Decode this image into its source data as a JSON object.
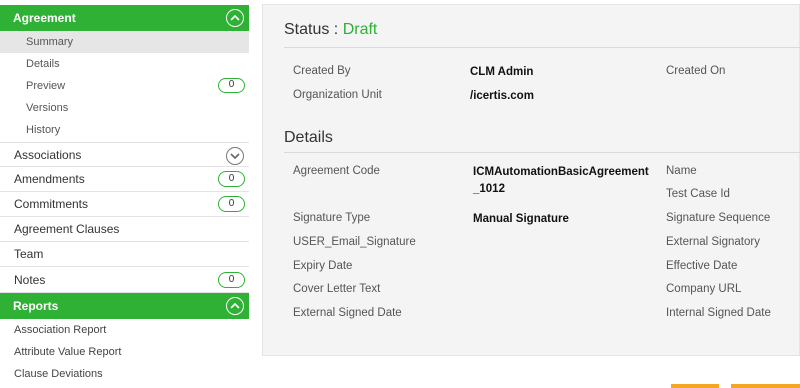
{
  "sidebar": {
    "agreement_header": "Agreement",
    "agreement_items": [
      {
        "label": "Summary"
      },
      {
        "label": "Details"
      },
      {
        "label": "Preview",
        "count": "0"
      },
      {
        "label": "Versions"
      },
      {
        "label": "History"
      }
    ],
    "categories": [
      {
        "label": "Associations"
      },
      {
        "label": "Amendments",
        "count": "0"
      },
      {
        "label": "Commitments",
        "count": "0"
      },
      {
        "label": "Agreement Clauses"
      },
      {
        "label": "Team"
      },
      {
        "label": "Notes",
        "count": "0"
      }
    ],
    "reports_header": "Reports",
    "reports": [
      {
        "label": "Association Report"
      },
      {
        "label": "Attribute Value Report"
      },
      {
        "label": "Clause Deviations"
      }
    ]
  },
  "main": {
    "status_label": "Status :",
    "status_value": "Draft",
    "created_by_label": "Created By",
    "created_by_value": "CLM Admin",
    "created_on_label": "Created On",
    "org_unit_label": "Organization Unit",
    "org_unit_value": "/icertis.com",
    "details_title": "Details",
    "agreement_code_label": "Agreement Code",
    "agreement_code_value_line1": "ICMAutomationBasicAgreement",
    "agreement_code_value_line2": "_1012",
    "name_label": "Name",
    "test_case_label": "Test Case Id",
    "signature_type_label": "Signature Type",
    "signature_type_value": "Manual Signature",
    "signature_sequence_label": "Signature Sequence",
    "user_email_label": "USER_Email_Signature",
    "external_signatory_label": "External Signatory",
    "expiry_date_label": "Expiry Date",
    "effective_date_label": "Effective Date",
    "cover_letter_label": "Cover Letter Text",
    "company_url_label": "Company URL",
    "external_signed_label": "External Signed Date",
    "internal_signed_label": "Internal Signed Date"
  },
  "colors": {
    "accent": "#2eb135",
    "orange": "#f5a623"
  }
}
